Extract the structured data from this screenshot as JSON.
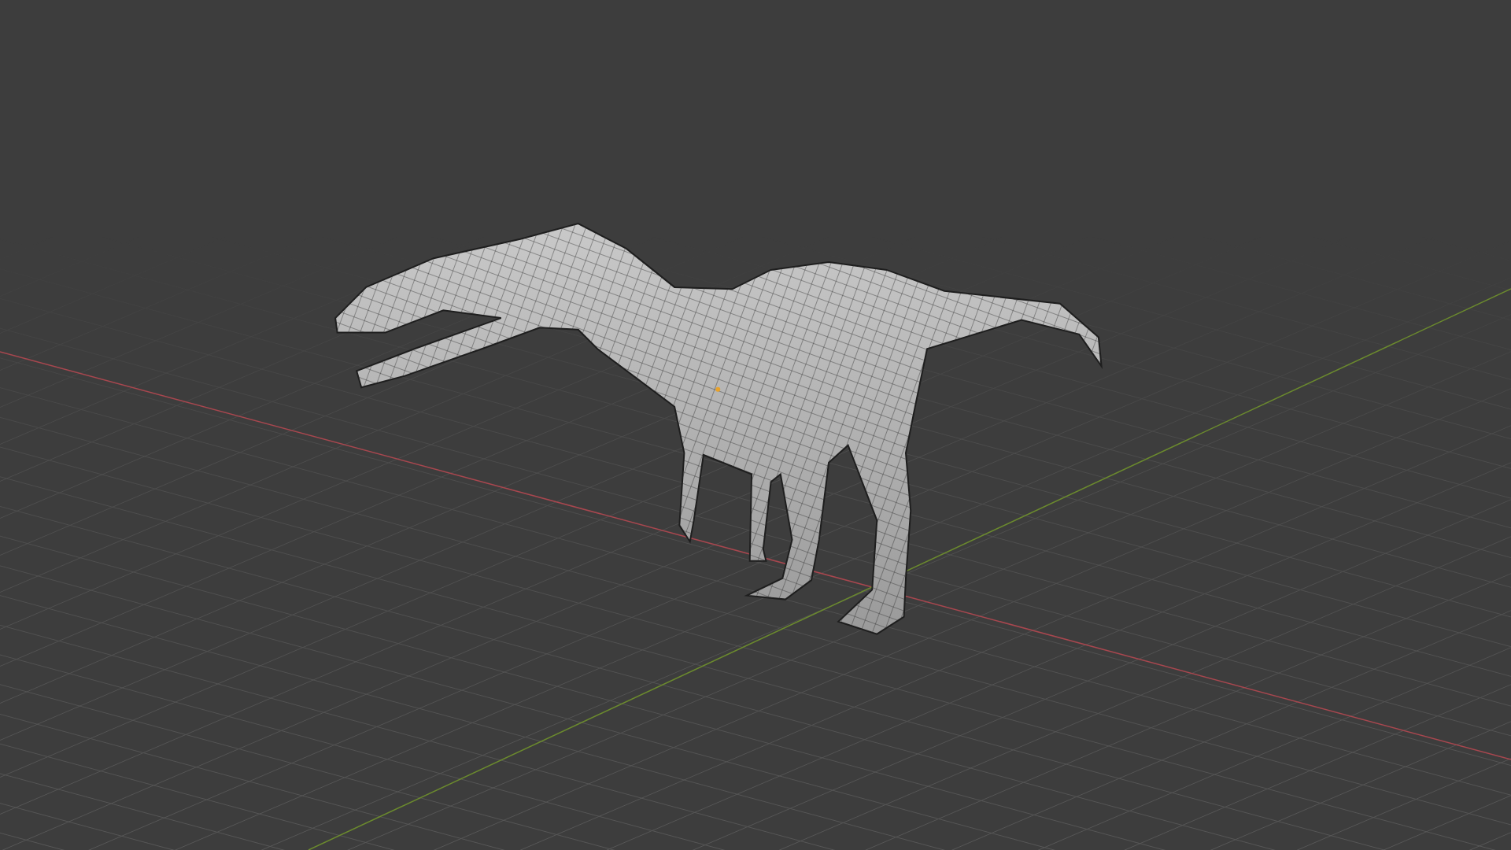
{
  "viewport": {
    "show_grid": true,
    "show_axes": true,
    "show_origin": true
  }
}
